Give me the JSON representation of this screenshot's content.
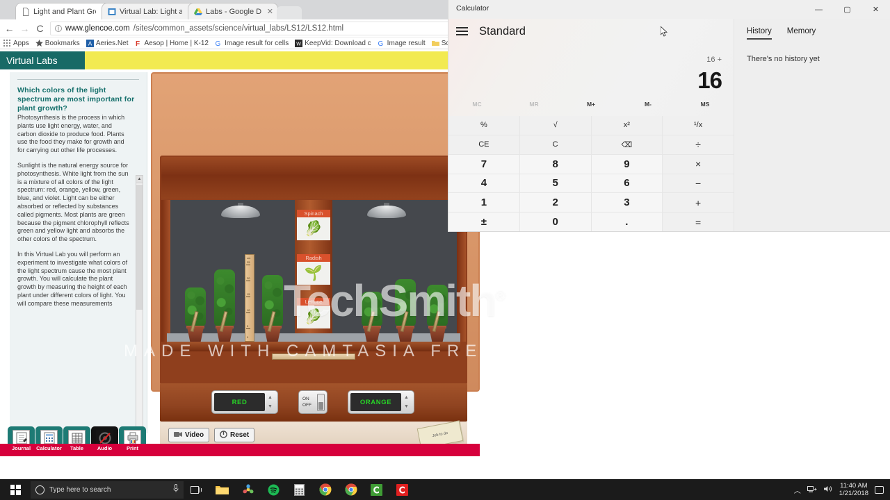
{
  "browser": {
    "tabs": [
      {
        "label": "Light and Plant Growth",
        "icon": "page-icon",
        "active": true
      },
      {
        "label": "Virtual Lab: Light and Pla",
        "icon": "doc-icon",
        "active": false
      },
      {
        "label": "Labs - Google Drive",
        "icon": "drive-icon",
        "active": false
      }
    ],
    "close_glyph": "✕",
    "nav": {
      "back": "←",
      "forward": "→",
      "reload": "C",
      "info": "i"
    },
    "url_host": "www.glencoe.com",
    "url_path": "/sites/common_assets/science/virtual_labs/LS12/LS12.html",
    "bookmarks": [
      {
        "label": "Apps",
        "icon": "apps-grid-icon"
      },
      {
        "label": "Bookmarks",
        "icon": "star-icon"
      },
      {
        "label": "Aeries.Net",
        "icon": "aeries-icon"
      },
      {
        "label": "Aesop | Home | K-12",
        "icon": "aesop-icon"
      },
      {
        "label": "Image result for cells",
        "icon": "google-icon"
      },
      {
        "label": "KeepVid: Download c",
        "icon": "keepvid-icon"
      },
      {
        "label": "Image result",
        "icon": "google-icon"
      },
      {
        "label": "School Resources",
        "icon": "folder-icon"
      },
      {
        "label": "",
        "icon": "page-icon"
      }
    ]
  },
  "page": {
    "site_title": "Virtual Labs",
    "question": "Which colors of the light spectrum are most important for plant growth?",
    "paragraphs": [
      "Photosynthesis is the process in which plants use light energy, water, and carbon dioxide to produce food. Plants use the food they make for growth and for carrying out other life processes.",
      "Sunlight is the natural energy source for photosynthesis. White light from the sun is a mixture of all colors of the light spectrum: red, orange, yellow, green, blue, and violet. Light can be either absorbed or reflected by substances called pigments. Most plants are green because the pigment chlorophyll reflects green and yellow light and absorbs the other colors of the spectrum.",
      "In this Virtual Lab you will perform an experiment to investigate what colors of the light spectrum cause the most plant growth. You will calculate the plant growth by measuring the height of each plant under different colors of light. You will compare these measurements"
    ],
    "scroll_up": "▲",
    "scroll_down": "▼",
    "veg_cards": [
      {
        "label": "Spinach",
        "glyph": "🥬"
      },
      {
        "label": "Radish",
        "glyph": "🌱"
      },
      {
        "label": "Lettuce",
        "glyph": "🥬"
      }
    ],
    "controls": {
      "left_color": "RED",
      "right_color": "ORANGE",
      "switch_on": "ON",
      "switch_off": "OFF",
      "spin_up": "▲",
      "spin_down": "▼"
    },
    "buttons": [
      {
        "label": "Video",
        "icon": "video-camera-icon"
      },
      {
        "label": "Reset",
        "icon": "power-icon"
      }
    ],
    "notepad_text": "Job to do",
    "ruler_unit": "cm",
    "ruler_marks": [
      "25",
      "20",
      "15",
      "10",
      "5",
      "0"
    ],
    "tools": [
      {
        "label": "Journal",
        "icon": "notebook-icon",
        "glyph": "📓"
      },
      {
        "label": "Calculator",
        "icon": "calculator-icon",
        "glyph": "🖩"
      },
      {
        "label": "Table",
        "icon": "table-icon",
        "glyph": "▦"
      },
      {
        "label": "Audio",
        "icon": "audio-muted-icon",
        "glyph": "🔇"
      },
      {
        "label": "Print",
        "icon": "printer-icon",
        "glyph": "🖨"
      }
    ],
    "watermark_main": "TechSmith",
    "watermark_reg": "®",
    "watermark_sub": "MADE WITH CAMTASIA FREE TRIAL"
  },
  "calculator": {
    "window_title": "Calculator",
    "minimize": "—",
    "maximize": "▢",
    "close": "✕",
    "menu_icon": "hamburger-icon",
    "mode": "Standard",
    "expression": "16 +",
    "display": "16",
    "memory_keys": [
      {
        "label": "MC",
        "disabled": true
      },
      {
        "label": "MR",
        "disabled": true
      },
      {
        "label": "M+",
        "disabled": false
      },
      {
        "label": "M-",
        "disabled": false
      },
      {
        "label": "MS",
        "disabled": false
      }
    ],
    "keys": [
      {
        "label": "%",
        "kind": "fn"
      },
      {
        "label": "√",
        "kind": "fn"
      },
      {
        "label": "x²",
        "kind": "fn"
      },
      {
        "label": "¹/x",
        "kind": "fn"
      },
      {
        "label": "CE",
        "kind": "fn"
      },
      {
        "label": "C",
        "kind": "fn"
      },
      {
        "label": "⌫",
        "kind": "fn"
      },
      {
        "label": "÷",
        "kind": "op"
      },
      {
        "label": "7",
        "kind": "num"
      },
      {
        "label": "8",
        "kind": "num"
      },
      {
        "label": "9",
        "kind": "num"
      },
      {
        "label": "×",
        "kind": "op"
      },
      {
        "label": "4",
        "kind": "num"
      },
      {
        "label": "5",
        "kind": "num"
      },
      {
        "label": "6",
        "kind": "num"
      },
      {
        "label": "−",
        "kind": "op"
      },
      {
        "label": "1",
        "kind": "num"
      },
      {
        "label": "2",
        "kind": "num"
      },
      {
        "label": "3",
        "kind": "num"
      },
      {
        "label": "+",
        "kind": "op"
      },
      {
        "label": "±",
        "kind": "num"
      },
      {
        "label": "0",
        "kind": "num"
      },
      {
        "label": ".",
        "kind": "num"
      },
      {
        "label": "=",
        "kind": "op"
      }
    ],
    "side_tabs": [
      {
        "label": "History",
        "active": true
      },
      {
        "label": "Memory",
        "active": false
      }
    ],
    "history_empty": "There's no history yet"
  },
  "taskbar": {
    "start_icon": "windows-logo-icon",
    "search_placeholder": "Type here to search",
    "mic_icon": "microphone-icon",
    "items": [
      {
        "icon": "task-view-icon",
        "glyph": "❐"
      },
      {
        "icon": "file-explorer-icon",
        "glyph": "🗀"
      },
      {
        "icon": "photos-icon",
        "glyph": "❀"
      },
      {
        "icon": "spotify-icon",
        "glyph": "●"
      },
      {
        "icon": "calculator-icon",
        "glyph": "▦"
      },
      {
        "icon": "chrome-icon",
        "glyph": "◉"
      },
      {
        "icon": "chrome-icon",
        "glyph": "◉"
      },
      {
        "icon": "camtasia-icon",
        "glyph": "C"
      },
      {
        "icon": "snagit-icon",
        "glyph": "C"
      }
    ],
    "tray": {
      "chevron": "︿",
      "network_icon": "network-icon",
      "volume_icon": "volume-icon",
      "time": "11:40 AM",
      "date": "1/21/2018",
      "notifications_icon": "action-center-icon"
    }
  }
}
